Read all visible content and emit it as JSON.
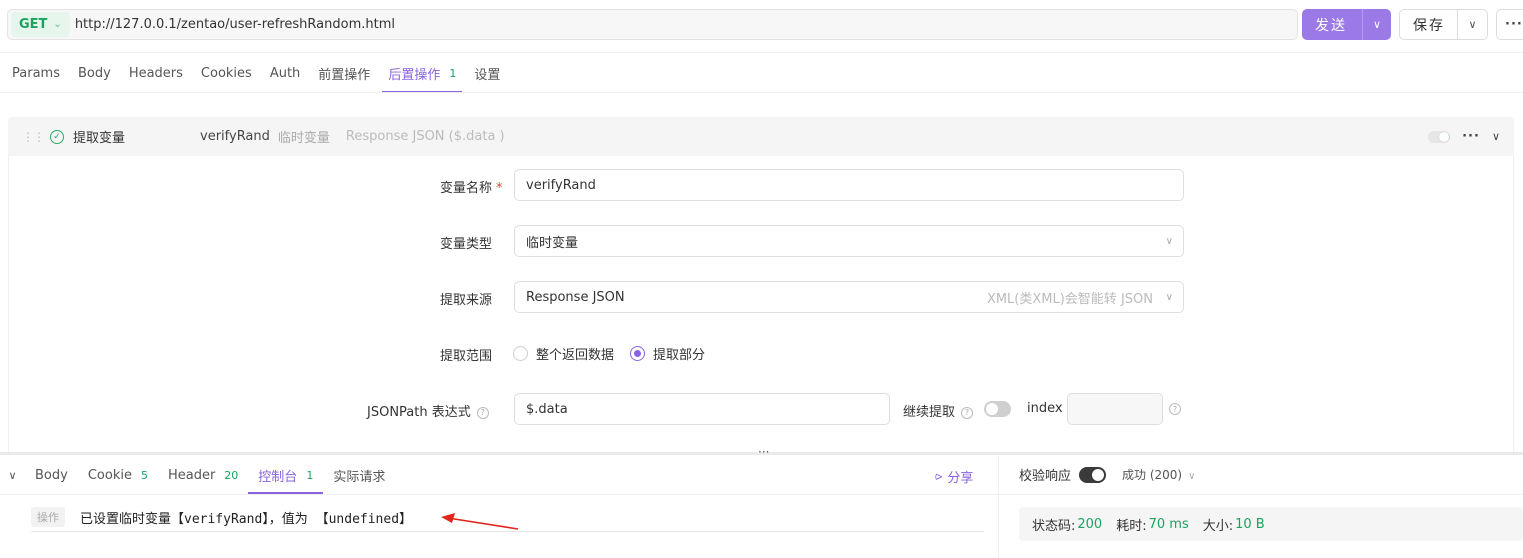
{
  "request": {
    "method": "GET",
    "url": "http://127.0.0.1/zentao/user-refreshRandom.html",
    "send_label": "发送",
    "save_label": "保存"
  },
  "req_tabs": [
    {
      "label": "Params"
    },
    {
      "label": "Body"
    },
    {
      "label": "Headers"
    },
    {
      "label": "Cookies"
    },
    {
      "label": "Auth"
    },
    {
      "label": "前置操作"
    },
    {
      "label": "后置操作",
      "count": "1"
    },
    {
      "label": "设置"
    }
  ],
  "processor": {
    "title": "提取变量",
    "var_name": "verifyRand",
    "var_type": "临时变量",
    "source_summary": "Response JSON ($.data )"
  },
  "form": {
    "name_label": "变量名称",
    "name_value": "verifyRand",
    "type_label": "变量类型",
    "type_value": "临时变量",
    "source_label": "提取来源",
    "source_value": "Response JSON",
    "source_hint": "XML(类XML)会智能转 JSON",
    "range_label": "提取范围",
    "range_options": [
      "整个返回数据",
      "提取部分"
    ],
    "range_selected": "提取部分",
    "jsonpath_label": "JSONPath 表达式",
    "jsonpath_value": "$.data",
    "continue_label": "继续提取",
    "index_label": "index",
    "index_value": ""
  },
  "resp_tabs": [
    {
      "label": "Body"
    },
    {
      "label": "Cookie",
      "count": "5"
    },
    {
      "label": "Header",
      "count": "20"
    },
    {
      "label": "控制台",
      "count": "1"
    },
    {
      "label": "实际请求"
    }
  ],
  "share_label": "分享",
  "console": {
    "tag": "操作",
    "message": "已设置临时变量【verifyRand】，值为 【undefined】"
  },
  "response": {
    "verify_label": "校验响应",
    "verify_on": true,
    "success_label": "成功 (200)",
    "status_label": "状态码:",
    "status_value": "200",
    "time_label": "耗时:",
    "time_value": "70 ms",
    "size_label": "大小:",
    "size_value": "10 B"
  },
  "colors": {
    "accent": "#8a63e0",
    "success": "#1aa35e",
    "annotation_arrow": "#e0251b"
  }
}
